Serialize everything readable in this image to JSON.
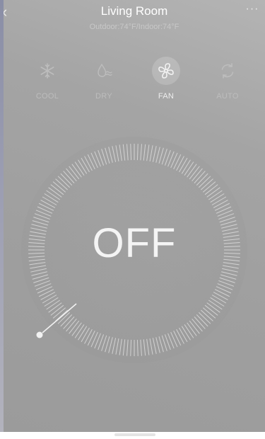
{
  "header": {
    "title": "Living Room",
    "subtitle": "Outdoor:74°F/Indoor:74°F",
    "back_icon": "chevron-left-icon",
    "more_icon": "more-icon",
    "back_glyph": "‹",
    "more_glyph": "···"
  },
  "modes": [
    {
      "label": "COOL",
      "icon": "snowflake-icon",
      "active": false
    },
    {
      "label": "DRY",
      "icon": "droplet-icon",
      "active": false
    },
    {
      "label": "FAN",
      "icon": "fan-icon",
      "active": true
    },
    {
      "label": "AUTO",
      "icon": "auto-cycle-icon",
      "active": false
    }
  ],
  "dial": {
    "power_state": "OFF"
  },
  "colors": {
    "background": "#a3a3a3",
    "text_primary": "#ffffff",
    "text_secondary": "#c8c8c8",
    "tick": "#e0e0e0"
  }
}
